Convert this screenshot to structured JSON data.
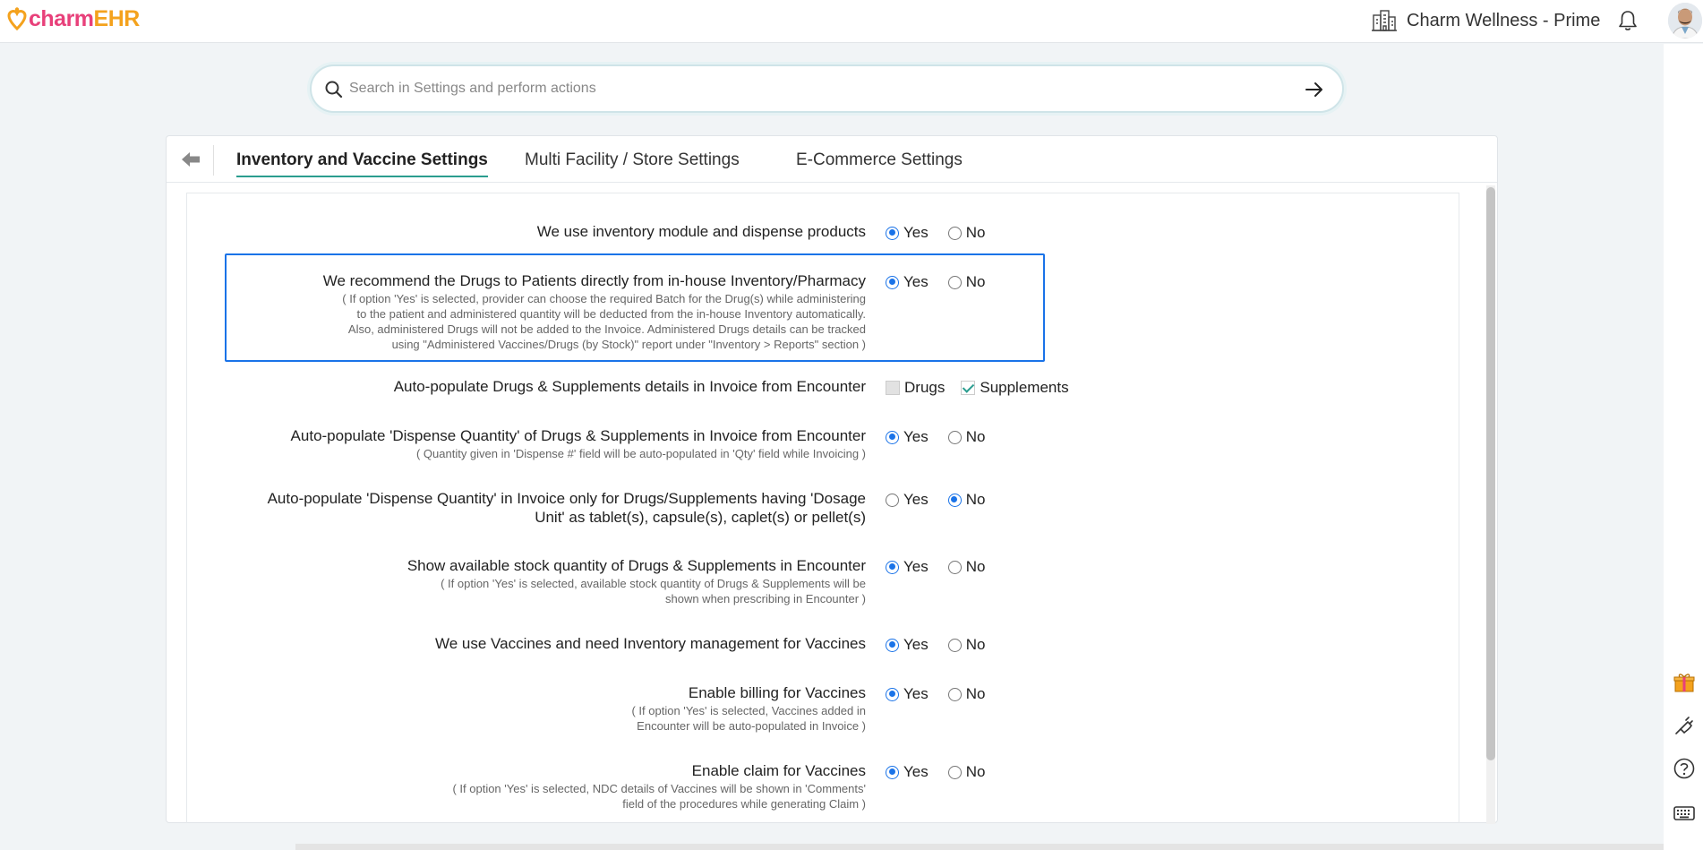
{
  "header": {
    "logo_charm": "charm",
    "logo_ehr": "EHR",
    "facility_name": "Charm Wellness - Prime"
  },
  "search": {
    "placeholder": "Search in Settings and perform actions"
  },
  "tabs": [
    {
      "label": "Inventory and Vaccine Settings",
      "active": true
    },
    {
      "label": "Multi Facility / Store Settings",
      "active": false
    },
    {
      "label": "E-Commerce Settings",
      "active": false
    }
  ],
  "settings": [
    {
      "label": "We use inventory module and dispense products",
      "yes_label": "Yes",
      "no_label": "No",
      "value": "Yes"
    },
    {
      "label": "We recommend the Drugs to Patients directly from in-house Inventory/Pharmacy",
      "sub": [
        "( If option 'Yes' is selected, provider can choose the required Batch for the Drug(s) while administering",
        "to the patient and administered quantity will be deducted from the in-house Inventory automatically.",
        "Also, administered Drugs will not be added to the Invoice. Administered Drugs details can be tracked",
        "using \"Administered Vaccines/Drugs (by Stock)\" report under \"Inventory > Reports\" section )"
      ],
      "yes_label": "Yes",
      "no_label": "No",
      "value": "Yes"
    },
    {
      "label": "Auto-populate Drugs & Supplements details in Invoice from Encounter",
      "checkboxes": [
        {
          "label": "Drugs",
          "checked": false
        },
        {
          "label": "Supplements",
          "checked": true
        }
      ]
    },
    {
      "label": "Auto-populate 'Dispense Quantity' of Drugs & Supplements in Invoice from Encounter",
      "sub": [
        "( Quantity given in 'Dispense #' field will be auto-populated in 'Qty' field while Invoicing )"
      ],
      "yes_label": "Yes",
      "no_label": "No",
      "value": "Yes"
    },
    {
      "label_lines": [
        "Auto-populate 'Dispense Quantity' in Invoice only for Drugs/Supplements having 'Dosage",
        "Unit' as tablet(s), capsule(s), caplet(s) or pellet(s)"
      ],
      "yes_label": "Yes",
      "no_label": "No",
      "value": "No"
    },
    {
      "label": "Show available stock quantity of Drugs & Supplements in Encounter",
      "sub": [
        "( If option 'Yes' is selected, available stock quantity of Drugs & Supplements will be",
        "shown when prescribing in Encounter )"
      ],
      "yes_label": "Yes",
      "no_label": "No",
      "value": "Yes"
    },
    {
      "label": "We use Vaccines and need Inventory management for Vaccines",
      "yes_label": "Yes",
      "no_label": "No",
      "value": "Yes"
    },
    {
      "label": "Enable billing for Vaccines",
      "sub": [
        "( If option 'Yes' is selected, Vaccines added in",
        "Encounter will be auto-populated in Invoice )"
      ],
      "yes_label": "Yes",
      "no_label": "No",
      "value": "Yes"
    },
    {
      "label": "Enable claim for Vaccines",
      "sub": [
        "( If option 'Yes' is selected, NDC details of Vaccines will be shown in 'Comments'",
        "field of the procedures while generating Claim )"
      ],
      "yes_label": "Yes",
      "no_label": "No",
      "value": "Yes"
    }
  ],
  "colors": {
    "accent": "#1a73e8",
    "tab_underline": "#2a9d8f",
    "logo_pink": "#e8407a",
    "logo_orange": "#f4a21d"
  }
}
